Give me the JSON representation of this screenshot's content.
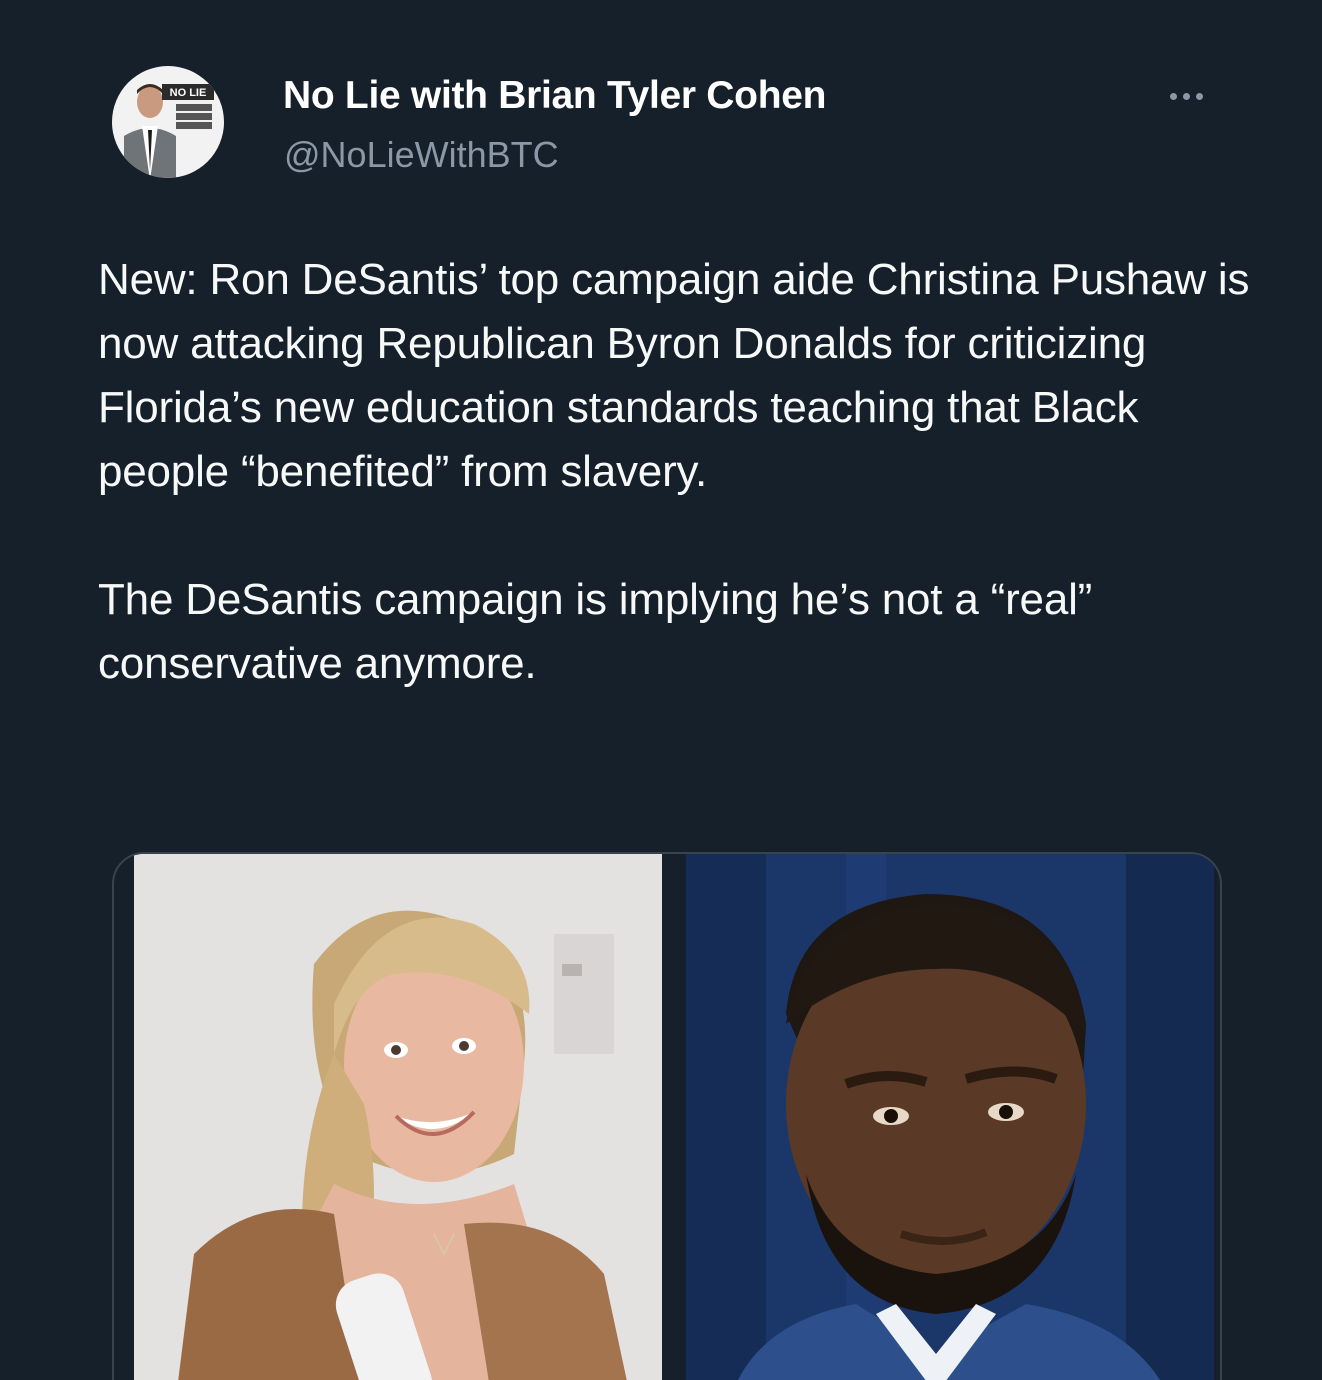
{
  "author": {
    "display_name": "No Lie with Brian Tyler Cohen",
    "handle": "@NoLieWithBTC",
    "avatar_icon": "profile-avatar"
  },
  "more_icon": "more-horizontal-icon",
  "tweet": {
    "paragraphs": [
      "New: Ron DeSantis’ top campaign aide Christina Pushaw is now attacking Republican Byron Donalds for criticizing Florida’s new education standards teaching that Black people “benefited” from slavery.",
      "The DeSantis campaign is implying he’s not a “real” conservative anymore."
    ]
  },
  "media": {
    "photos": [
      {
        "subject": "woman-photo"
      },
      {
        "subject": "man-photo"
      }
    ]
  },
  "colors": {
    "background": "#16202b",
    "text": "#f7f9f9",
    "secondary": "#8b98a5",
    "border": "#38444d"
  }
}
